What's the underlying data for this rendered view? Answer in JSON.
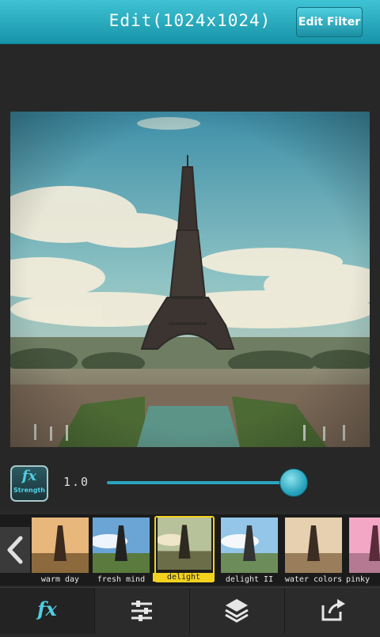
{
  "header": {
    "title": "Edit(1024x1024)",
    "edit_filter_label": "Edit Filter"
  },
  "strength": {
    "badge_fx": "fx",
    "badge_label": "Strength",
    "value_text": "1.0",
    "slider_fraction": 0.95
  },
  "filters": [
    {
      "name": "warm day"
    },
    {
      "name": "fresh mind"
    },
    {
      "name": "delight",
      "selected": true
    },
    {
      "name": "delight II"
    },
    {
      "name": "water colors"
    },
    {
      "name": "pinky"
    }
  ],
  "tabs": [
    {
      "icon": "fx-icon",
      "label": "fx"
    },
    {
      "icon": "sliders-icon"
    },
    {
      "icon": "layers-icon"
    },
    {
      "icon": "share-icon"
    }
  ],
  "colors": {
    "accent": "#2aa4bf",
    "header": "#1793a8",
    "selected": "#f2d21e"
  }
}
